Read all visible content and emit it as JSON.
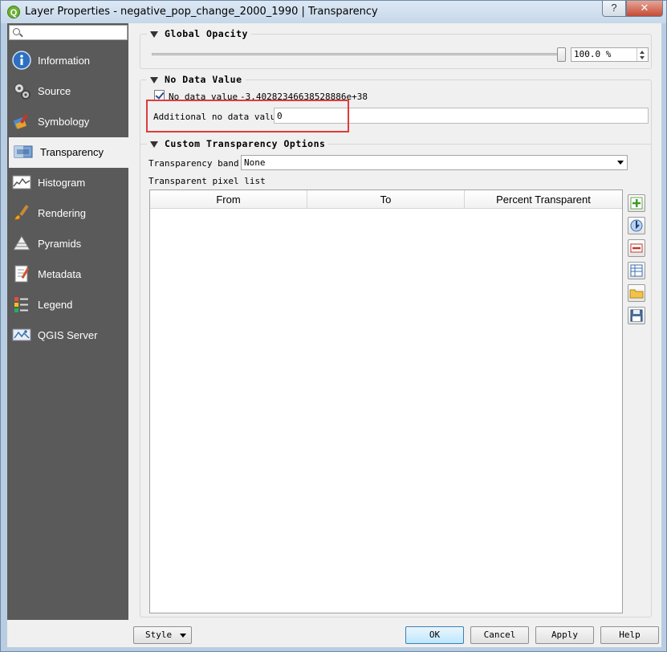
{
  "window": {
    "title": "Layer Properties - negative_pop_change_2000_1990 | Transparency",
    "help_label": "?",
    "close_label": "✕"
  },
  "sidebar": {
    "search_value": "",
    "items": [
      {
        "label": "Information",
        "icon": "info-icon"
      },
      {
        "label": "Source",
        "icon": "source-icon"
      },
      {
        "label": "Symbology",
        "icon": "symbology-icon"
      },
      {
        "label": "Transparency",
        "icon": "transparency-icon",
        "active": true
      },
      {
        "label": "Histogram",
        "icon": "histogram-icon"
      },
      {
        "label": "Rendering",
        "icon": "rendering-icon"
      },
      {
        "label": "Pyramids",
        "icon": "pyramids-icon"
      },
      {
        "label": "Metadata",
        "icon": "metadata-icon"
      },
      {
        "label": "Legend",
        "icon": "legend-icon"
      },
      {
        "label": "QGIS Server",
        "icon": "qgis-server-icon"
      }
    ]
  },
  "global_opacity": {
    "title": "Global Opacity",
    "value_text": "100.0 %",
    "level_percent": 100
  },
  "no_data": {
    "title": "No Data Value",
    "checkbox_label": "No data value",
    "checked": true,
    "value_text": "-3.40282346638528886e+38",
    "additional_label": "Additional no data value",
    "additional_value": "0"
  },
  "custom_transparency": {
    "title": "Custom Transparency Options",
    "band_label": "Transparency band",
    "band_value": "None",
    "list_label": "Transparent pixel list",
    "columns": [
      "From",
      "To",
      "Percent Transparent"
    ],
    "rows": []
  },
  "side_tools": [
    {
      "name": "add-row-icon"
    },
    {
      "name": "add-from-display-icon"
    },
    {
      "name": "remove-row-icon"
    },
    {
      "name": "default-values-icon"
    },
    {
      "name": "import-file-icon"
    },
    {
      "name": "export-file-icon"
    }
  ],
  "footer": {
    "style_label": "Style",
    "ok_label": "OK",
    "cancel_label": "Cancel",
    "apply_label": "Apply",
    "help_label": "Help"
  },
  "colors": {
    "sidebar_bg": "#5a5a5a",
    "highlight_box": "#e23a3a",
    "ok_button_border": "#3c7fb1"
  }
}
